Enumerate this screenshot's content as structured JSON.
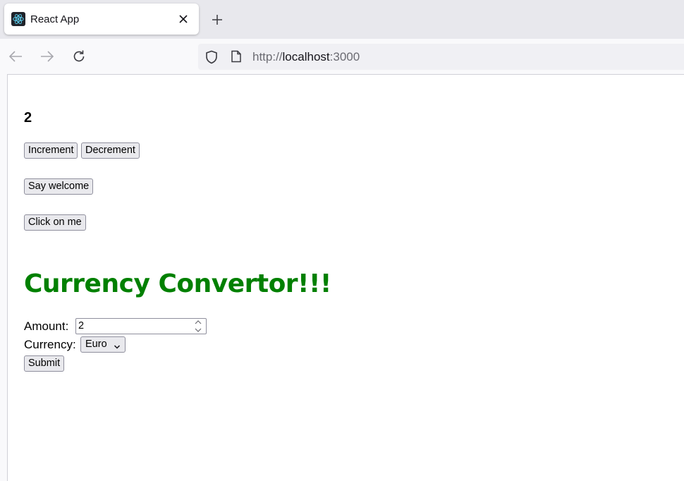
{
  "browser": {
    "tab_title": "React App",
    "url_scheme": "http://",
    "url_host": "localhost",
    "url_port": ":3000",
    "icons": [
      "react-logo-icon",
      "close-icon",
      "plus-icon",
      "back-arrow-icon",
      "forward-arrow-icon",
      "reload-icon",
      "shield-icon",
      "page-icon"
    ]
  },
  "app": {
    "counter_value": "2",
    "increment_label": "Increment",
    "decrement_label": "Decrement",
    "say_welcome_label": "Say welcome",
    "click_me_label": "Click on me",
    "heading": "Currency Convertor!!!",
    "heading_color": "#008000",
    "amount_label": "Amount:",
    "amount_value": "2",
    "currency_label": "Currency:",
    "currency_selected": "Euro",
    "submit_label": "Submit"
  }
}
